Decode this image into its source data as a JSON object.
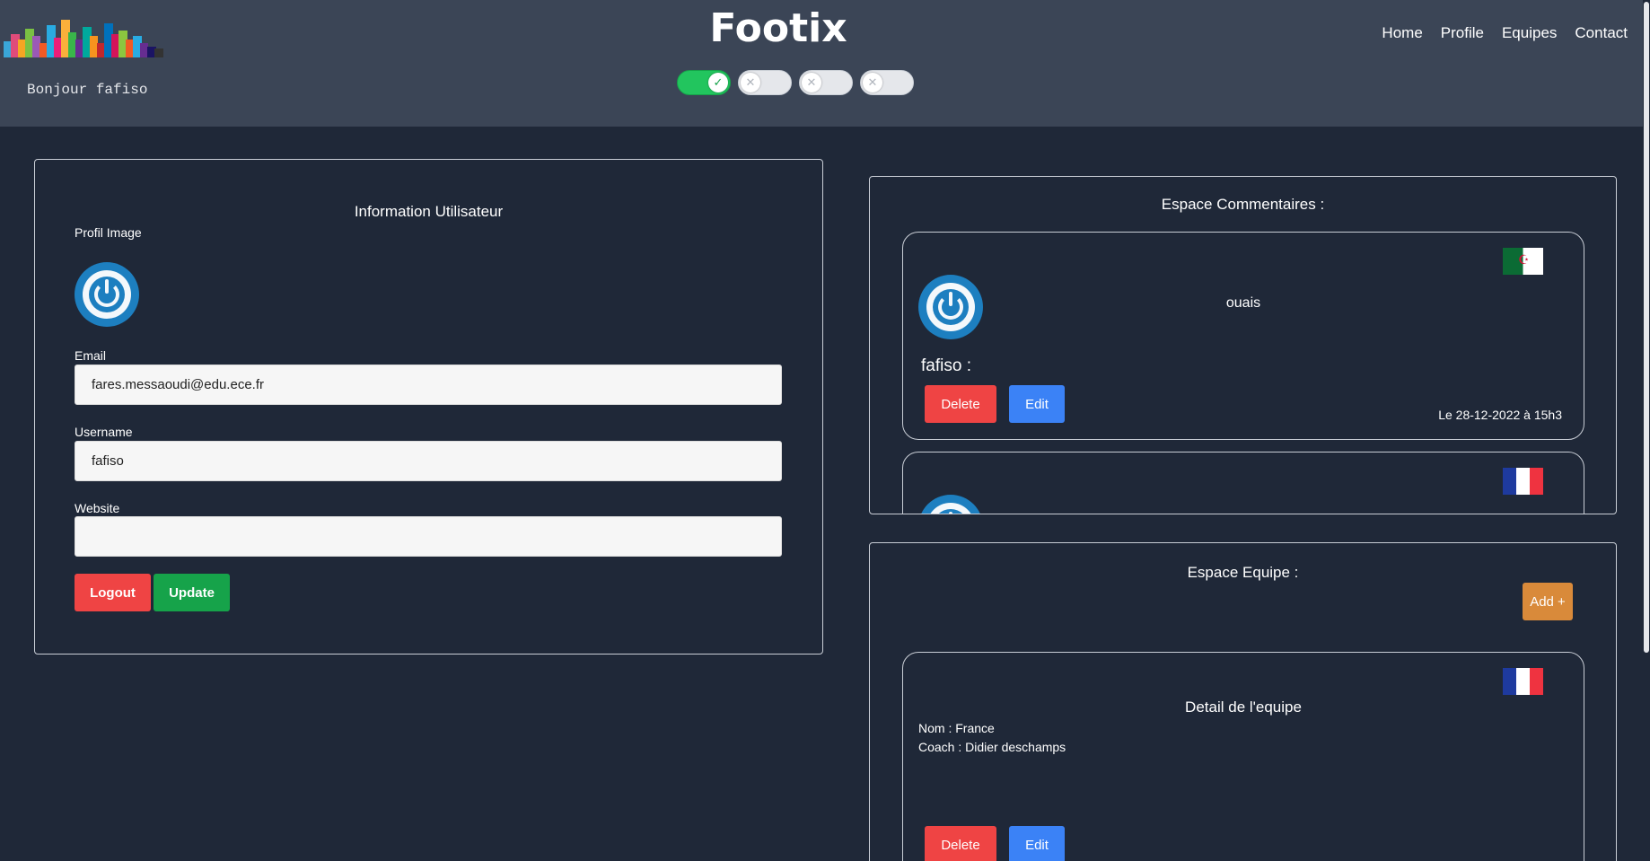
{
  "header": {
    "greeting": "Bonjour fafiso",
    "site_title": "Footix",
    "nav": {
      "home": "Home",
      "profile": "Profile",
      "equipes": "Equipes",
      "contact": "Contact"
    },
    "theme_toggles": [
      {
        "state": "on",
        "knob_icon": "check-icon"
      },
      {
        "state": "off",
        "knob_icon": "x-icon"
      },
      {
        "state": "off",
        "knob_icon": "x-icon"
      },
      {
        "state": "off",
        "knob_icon": "x-icon"
      }
    ]
  },
  "user_panel": {
    "title": "Information Utilisateur",
    "profile_image_label": "Profil Image",
    "email_label": "Email",
    "email_value": "fares.messaoudi@edu.ece.fr",
    "username_label": "Username",
    "username_value": "fafiso",
    "website_label": "Website",
    "website_value": "",
    "logout_label": "Logout",
    "update_label": "Update"
  },
  "comments_panel": {
    "title": "Espace Commentaires :",
    "comments": [
      {
        "text": "ouais",
        "author": "fafiso :",
        "date": "Le 28-12-2022 à 15h3",
        "flag": "algeria",
        "delete_label": "Delete",
        "edit_label": "Edit"
      },
      {
        "flag": "france"
      }
    ]
  },
  "teams_panel": {
    "title": "Espace Equipe :",
    "add_label": "Add +",
    "teams": [
      {
        "heading": "Detail de l'equipe",
        "name_line": "Nom : France",
        "coach_line": "Coach : Didier deschamps",
        "flag": "france",
        "delete_label": "Delete",
        "edit_label": "Edit"
      }
    ]
  },
  "colors": {
    "header_bg": "#3b4556",
    "page_bg": "#1f2838",
    "danger": "#ef4444",
    "success": "#16a34a",
    "primary": "#3b82f6",
    "warning": "#d98a3a",
    "france_blue": "#1e3a9e",
    "france_red": "#ef3340"
  }
}
